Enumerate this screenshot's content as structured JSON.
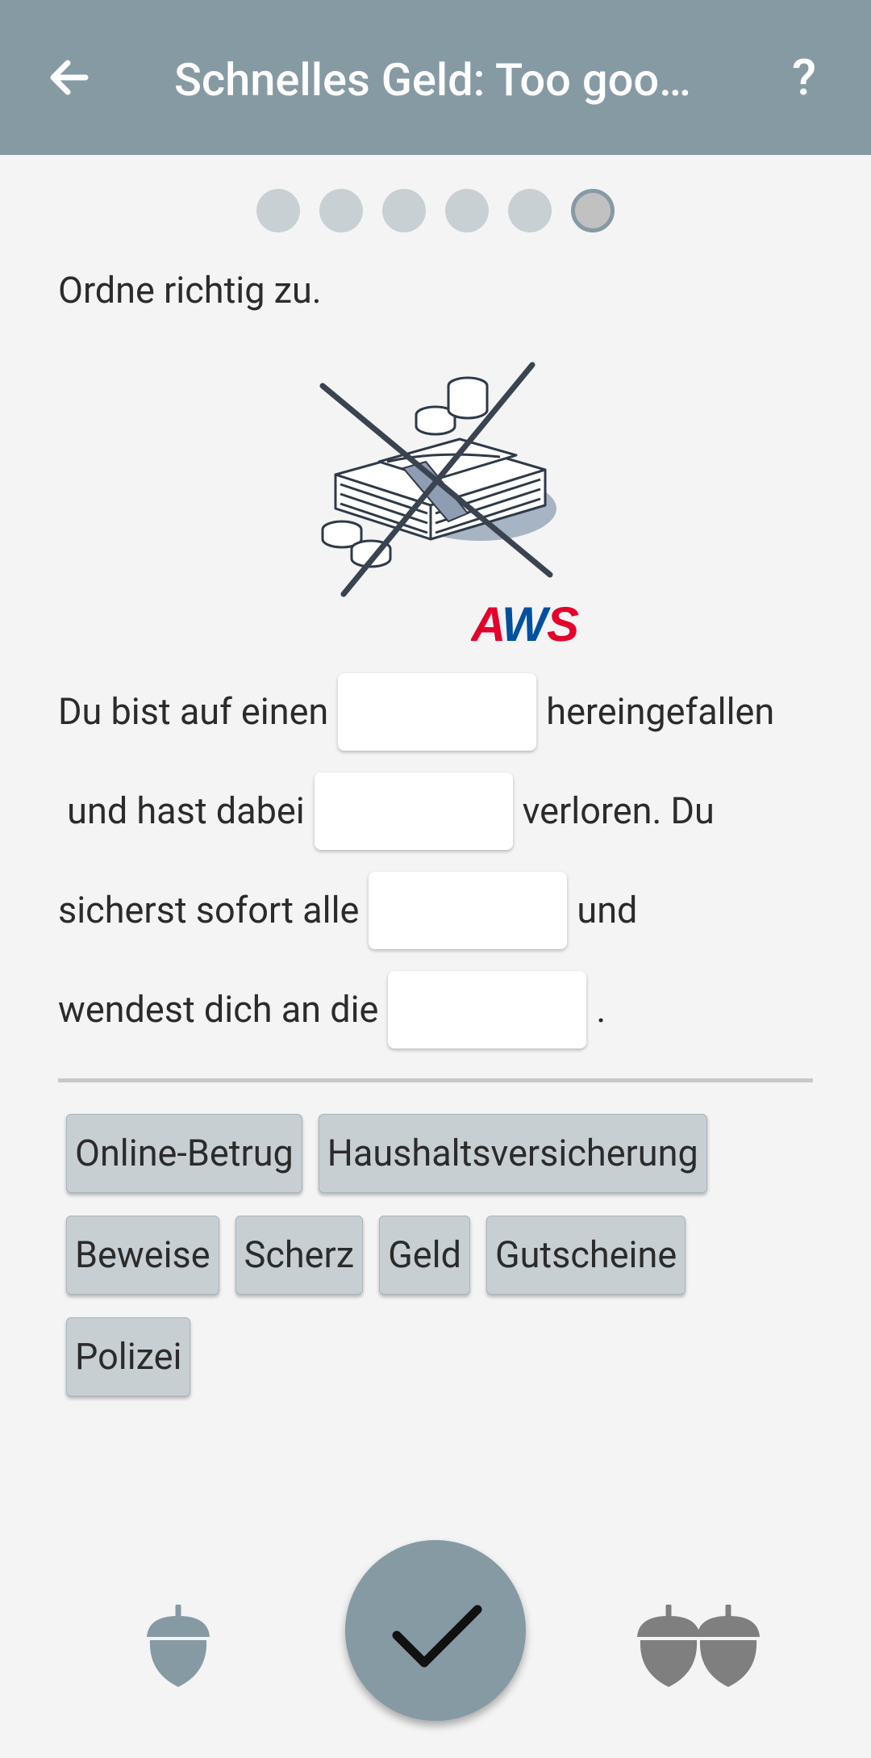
{
  "appbar": {
    "title": "Schnelles Geld: Too goo…",
    "help_label": "?",
    "back_icon": "arrow-left-icon"
  },
  "progress": {
    "total_steps": 6,
    "current_step": 6
  },
  "instruction": "Ordne richtig zu.",
  "illustration": {
    "icon": "crossed-out-money-icon",
    "logo_text": "AWS",
    "logo_colors": [
      "#e4002b",
      "#0050a0"
    ]
  },
  "sentence": {
    "l1a": "Du bist auf einen",
    "l1b": "hereingefallen",
    "l2a": " und hast dabei",
    "l2b": "verloren. Du",
    "l3a": "sicherst sofort alle",
    "l3b": "und",
    "l4a": "wendest dich an die",
    "l4b": "."
  },
  "chips": [
    "Online-Betrug",
    "Haushaltsversicherung",
    "Beweise",
    "Scherz",
    "Geld",
    "Gutscheine",
    "Polizei"
  ],
  "bottom": {
    "hint_one_icon": "acorn-icon",
    "check_icon": "checkmark-icon",
    "hint_two_icon": "double-acorn-icon"
  },
  "colors": {
    "appbar": "#869aa4",
    "chip": "#c7cfd3",
    "background": "#f4f4f4"
  }
}
